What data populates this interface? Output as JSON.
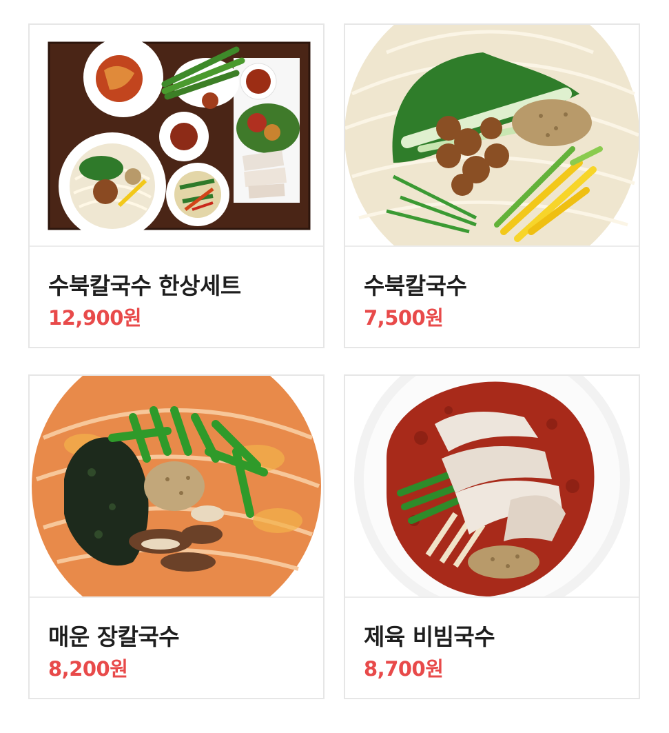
{
  "menu": [
    {
      "name": "수북칼국수 한상세트",
      "price": "12,900원",
      "image": "hansang-set-photo"
    },
    {
      "name": "수북칼국수",
      "price": "7,500원",
      "image": "subuk-kalguksu-photo"
    },
    {
      "name": "매운 장칼국수",
      "price": "8,200원",
      "image": "spicy-jang-kalguksu-photo"
    },
    {
      "name": "제육 비빔국수",
      "price": "8,700원",
      "image": "jeyuk-bibim-guksu-photo"
    }
  ],
  "colors": {
    "price": "#e84a4a",
    "name": "#1e1e1e",
    "border": "#e6e6e6"
  }
}
